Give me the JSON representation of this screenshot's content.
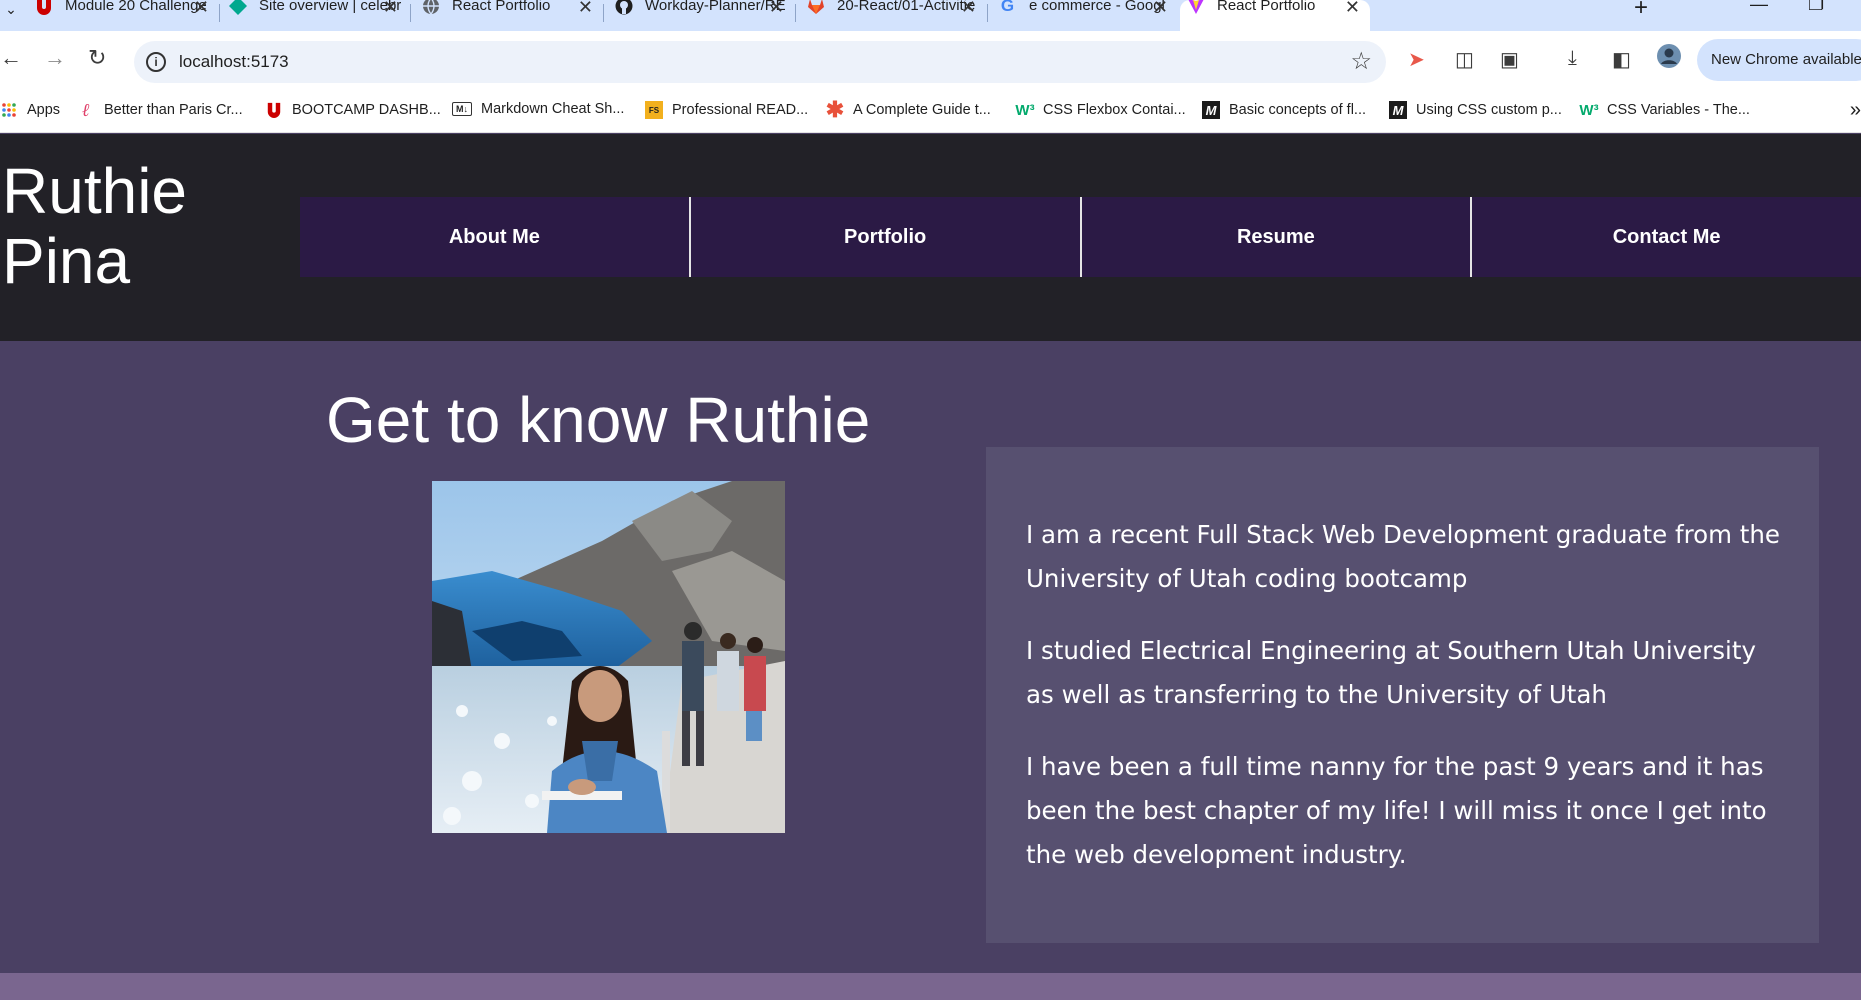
{
  "browser": {
    "tabs": [
      {
        "title": "Module 20 Challenge",
        "favicon": "utah-u-icon",
        "color": "#cc0000",
        "active": false
      },
      {
        "title": "Site overview | celebr",
        "favicon": "diamond-icon",
        "color": "#00a88f",
        "active": false
      },
      {
        "title": "React Portfolio",
        "favicon": "globe-icon",
        "color": "#5f6368",
        "active": false
      },
      {
        "title": "Workday-Planner/RE",
        "favicon": "github-icon",
        "color": "#1f1f1f",
        "active": false
      },
      {
        "title": "20-React/01-Activitie",
        "favicon": "gitlab-icon",
        "color": "#e24329",
        "active": false
      },
      {
        "title": "e commerce - Googl",
        "favicon": "google-icon",
        "color": "#4285f4",
        "active": false
      },
      {
        "title": "React Portfolio",
        "favicon": "vite-icon",
        "color": "#bd34fe",
        "active": true
      }
    ],
    "url": "localhost:5173",
    "update_label": "New Chrome available",
    "bookmarks": [
      {
        "label": "Apps",
        "favicon": "apps-grid-icon"
      },
      {
        "label": "Better than Paris Cr...",
        "favicon": "script-l-icon"
      },
      {
        "label": "BOOTCAMP DASHB...",
        "favicon": "utah-u-icon"
      },
      {
        "label": "Markdown Cheat Sh...",
        "favicon": "markdown-icon"
      },
      {
        "label": "Professional READ...",
        "favicon": "fs-icon"
      },
      {
        "label": "A Complete Guide t...",
        "favicon": "asterisk-icon"
      },
      {
        "label": "CSS Flexbox Contai...",
        "favicon": "w3-icon"
      },
      {
        "label": "Basic concepts of fl...",
        "favicon": "mdn-icon"
      },
      {
        "label": "Using CSS custom p...",
        "favicon": "mdn-icon"
      },
      {
        "label": "CSS Variables - The...",
        "favicon": "w3-icon"
      }
    ]
  },
  "site": {
    "name": "Ruthie Pina",
    "nav": [
      {
        "label": "About Me"
      },
      {
        "label": "Portfolio"
      },
      {
        "label": "Resume"
      },
      {
        "label": "Contact Me"
      }
    ],
    "about": {
      "heading": "Get to know Ruthie",
      "paragraphs": [
        "I am a recent Full Stack Web Development graduate from the University of Utah coding bootcamp",
        "I studied Electrical Engineering at Southern Utah University as well as transferring to the University of Utah",
        "I have been a full time nanny for the past 9 years and it has been the best chapter of my life! I will miss it once I get into the web development industry."
      ]
    },
    "colors": {
      "header_bg": "#222127",
      "nav_bg": "#2b1a45",
      "main_bg": "#4a4063",
      "card_bg": "#575070",
      "footer_bg": "#7a668f"
    }
  }
}
